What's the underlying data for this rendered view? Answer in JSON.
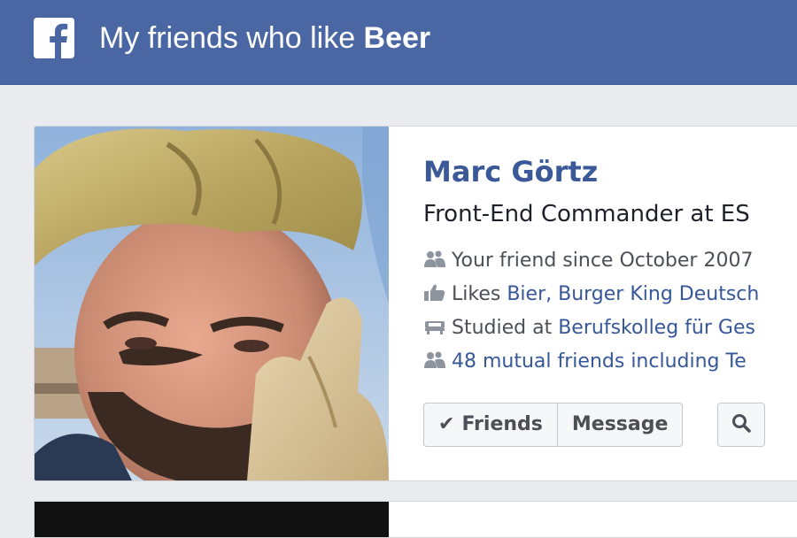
{
  "header": {
    "logo_icon": "facebook-f-icon",
    "title_prefix": "My friends who like ",
    "title_bold": "Beer",
    "background_color": "#4a67a3"
  },
  "card": {
    "name": "Marc Görtz",
    "role": "Front-End Commander at ES",
    "facts": [
      {
        "icon": "friends-icon",
        "prefix": "Your friend since October 2007",
        "link": ""
      },
      {
        "icon": "thumbs-up-icon",
        "prefix": "Likes ",
        "link": "Bier, Burger King Deutsch"
      },
      {
        "icon": "school-icon",
        "prefix": "Studied at ",
        "link": "Berufskolleg für Ges"
      },
      {
        "icon": "friends-icon",
        "prefix": "",
        "link": "48 mutual friends including Te"
      }
    ],
    "buttons": {
      "friends_label": "Friends",
      "message_label": "Message",
      "search_icon": "search-icon"
    },
    "link_color": "#365899",
    "name_color": "#3b5998"
  }
}
